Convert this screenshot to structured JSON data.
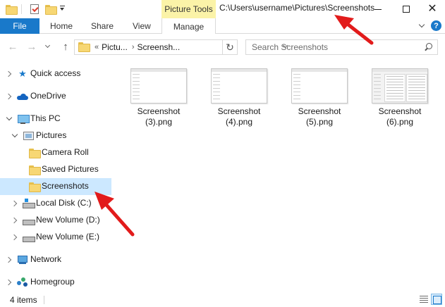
{
  "titlebar": {
    "context_tab_group": "Picture Tools",
    "path": "C:\\Users\\username\\Pictures\\Screenshots"
  },
  "ribbon": {
    "tabs": [
      "File",
      "Home",
      "Share",
      "View",
      "Manage"
    ],
    "help_glyph": "?"
  },
  "address": {
    "overflow": "«",
    "crumbs": [
      "Pictu...",
      "Screensh..."
    ],
    "separator": "›"
  },
  "search": {
    "placeholder": "Search Screenshots"
  },
  "nav": {
    "items": [
      {
        "label": "Quick access",
        "icon": "star-icon"
      },
      {
        "label": "OneDrive",
        "icon": "cloud-icon"
      },
      {
        "label": "This PC",
        "icon": "computer-icon"
      },
      {
        "label": "Pictures",
        "icon": "pictures-library-icon"
      },
      {
        "label": "Camera Roll",
        "icon": "folder-icon"
      },
      {
        "label": "Saved Pictures",
        "icon": "folder-icon"
      },
      {
        "label": "Screenshots",
        "icon": "folder-icon",
        "selected": true
      },
      {
        "label": "Local Disk (C:)",
        "icon": "windows-drive-icon"
      },
      {
        "label": "New Volume (D:)",
        "icon": "drive-icon"
      },
      {
        "label": "New Volume (E:)",
        "icon": "drive-icon"
      },
      {
        "label": "Network",
        "icon": "network-icon"
      },
      {
        "label": "Homegroup",
        "icon": "homegroup-icon"
      }
    ]
  },
  "files": [
    {
      "line1": "Screenshot",
      "line2": "(3).png"
    },
    {
      "line1": "Screenshot",
      "line2": "(4).png"
    },
    {
      "line1": "Screenshot",
      "line2": "(5).png"
    },
    {
      "line1": "Screenshot",
      "line2": "(6).png"
    }
  ],
  "status": {
    "item_count": "4 items"
  },
  "colors": {
    "accent": "#1979ca",
    "context_tab": "#fbf3a8",
    "selection": "#cce8ff",
    "annotation": "#e21b1b"
  }
}
